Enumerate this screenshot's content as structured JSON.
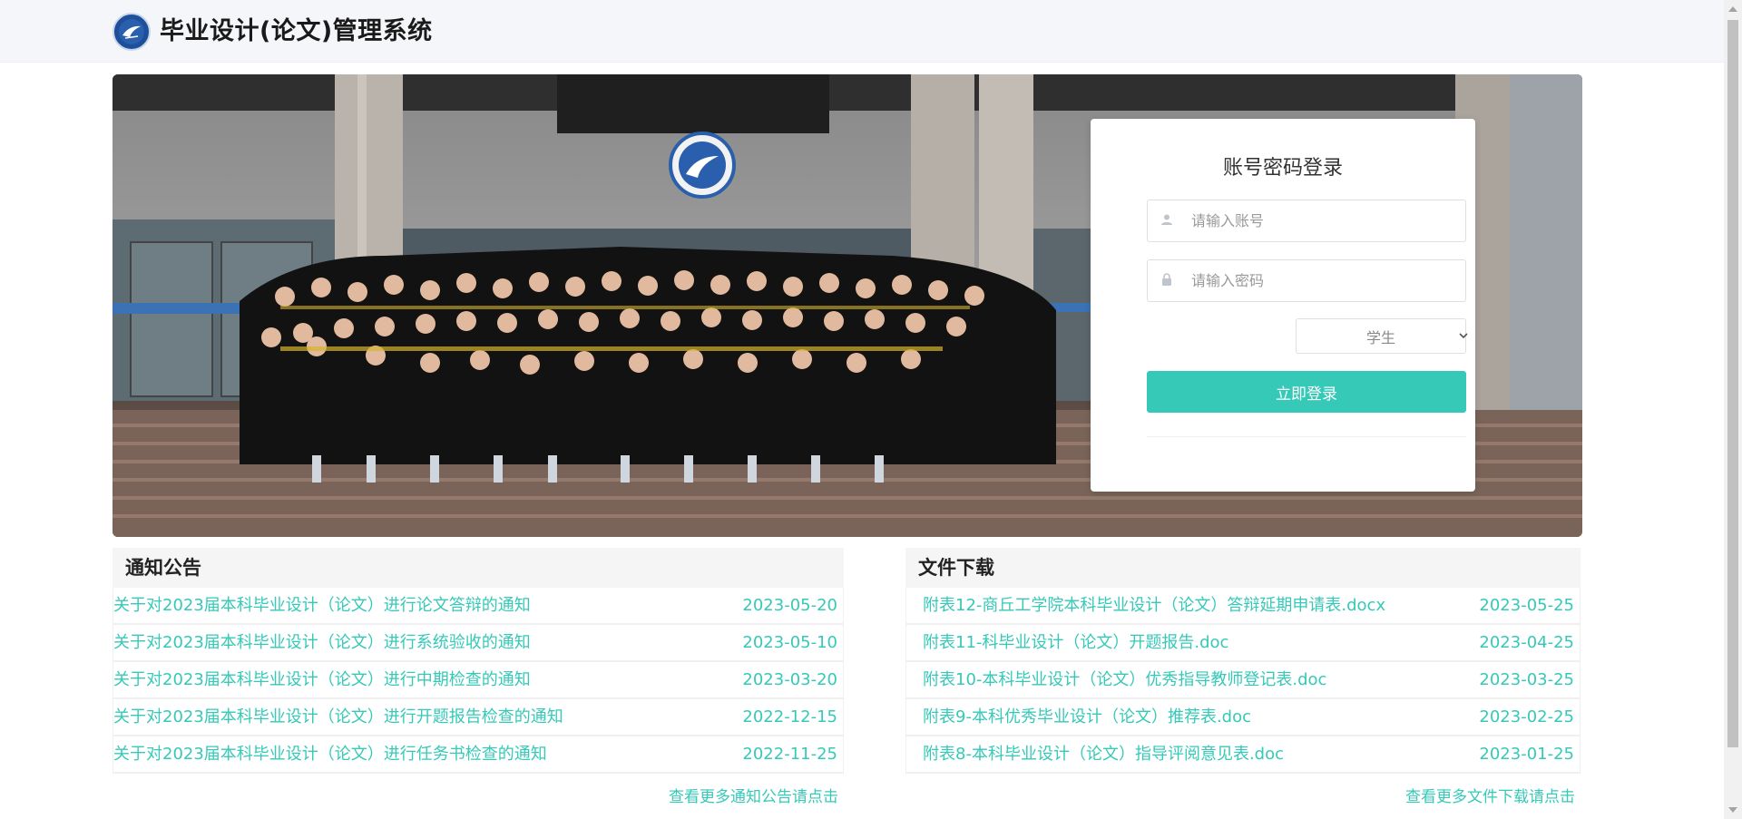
{
  "header": {
    "title": "毕业设计(论文)管理系统",
    "logo_icon": "university-logo-icon"
  },
  "login": {
    "title": "账号密码登录",
    "username_placeholder": "请输入账号",
    "password_placeholder": "请输入密码",
    "role_selected": "学生",
    "submit_label": "立即登录",
    "accent": "#36c9b7"
  },
  "notices": {
    "heading": "通知公告",
    "items": [
      {
        "title": "关于对2023届本科毕业设计（论文）进行论文答辩的通知",
        "date": "2023-05-20"
      },
      {
        "title": "关于对2023届本科毕业设计（论文）进行系统验收的通知",
        "date": "2023-05-10"
      },
      {
        "title": "关于对2023届本科毕业设计（论文）进行中期检查的通知",
        "date": "2023-03-20"
      },
      {
        "title": "关于对2023届本科毕业设计（论文）进行开题报告检查的通知",
        "date": "2022-12-15"
      },
      {
        "title": "关于对2023届本科毕业设计（论文）进行任务书检查的通知",
        "date": "2022-11-25"
      }
    ],
    "more_label": "查看更多通知公告请点击"
  },
  "downloads": {
    "heading": "文件下载",
    "items": [
      {
        "title": "附表12-商丘工学院本科毕业设计（论文）答辩延期申请表.docx",
        "date": "2023-05-25"
      },
      {
        "title": "附表11-科毕业设计（论文）开题报告.doc",
        "date": "2023-04-25"
      },
      {
        "title": "附表10-本科毕业设计（论文）优秀指导教师登记表.doc",
        "date": "2023-03-25"
      },
      {
        "title": "附表9-本科优秀毕业设计（论文）推荐表.doc",
        "date": "2023-02-25"
      },
      {
        "title": "附表8-本科毕业设计（论文）指导评阅意见表.doc",
        "date": "2023-01-25"
      }
    ],
    "more_label": "查看更多文件下载请点击"
  }
}
